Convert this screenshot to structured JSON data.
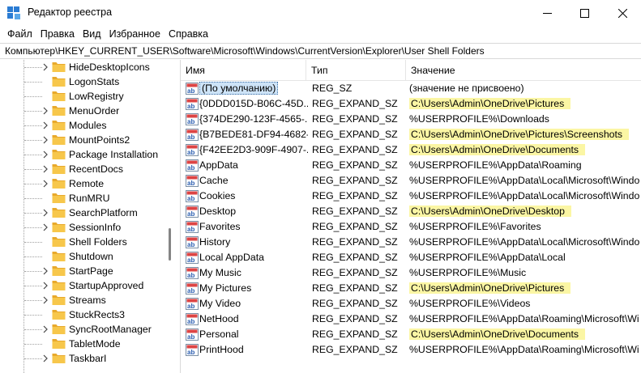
{
  "window": {
    "title": "Редактор реестра",
    "icon": "registry-editor-icon"
  },
  "menu": [
    "Файл",
    "Правка",
    "Вид",
    "Избранное",
    "Справка"
  ],
  "address": "Компьютер\\HKEY_CURRENT_USER\\Software\\Microsoft\\Windows\\CurrentVersion\\Explorer\\User Shell Folders",
  "tree": {
    "items": [
      "HideDesktopIcons",
      "LogonStats",
      "LowRegistry",
      "MenuOrder",
      "Modules",
      "MountPoints2",
      "Package Installation",
      "RecentDocs",
      "Remote",
      "RunMRU",
      "SearchPlatform",
      "SessionInfo",
      "Shell Folders",
      "Shutdown",
      "StartPage",
      "StartupApproved",
      "Streams",
      "StuckRects3",
      "SyncRootManager",
      "TabletMode",
      "TaskbarI"
    ],
    "expandable": [
      true,
      false,
      false,
      true,
      true,
      true,
      true,
      true,
      true,
      false,
      true,
      true,
      false,
      false,
      true,
      true,
      true,
      false,
      true,
      false,
      true
    ]
  },
  "columns": {
    "name": "Имя",
    "type": "Тип",
    "value": "Значение"
  },
  "rows": [
    {
      "name": "(По умолчанию)",
      "type": "REG_SZ",
      "value": "(значение не присвоено)",
      "highlight": false,
      "selected": true
    },
    {
      "name": "{0DDD015D-B06C-45D...",
      "type": "REG_EXPAND_SZ",
      "value": "C:\\Users\\Admin\\OneDrive\\Pictures",
      "highlight": true
    },
    {
      "name": "{374DE290-123F-4565-...",
      "type": "REG_EXPAND_SZ",
      "value": "%USERPROFILE%\\Downloads",
      "highlight": false
    },
    {
      "name": "{B7BEDE81-DF94-4682-...",
      "type": "REG_EXPAND_SZ",
      "value": "C:\\Users\\Admin\\OneDrive\\Pictures\\Screenshots",
      "highlight": true
    },
    {
      "name": "{F42EE2D3-909F-4907-...",
      "type": "REG_EXPAND_SZ",
      "value": "C:\\Users\\Admin\\OneDrive\\Documents",
      "highlight": true
    },
    {
      "name": "AppData",
      "type": "REG_EXPAND_SZ",
      "value": "%USERPROFILE%\\AppData\\Roaming",
      "highlight": false
    },
    {
      "name": "Cache",
      "type": "REG_EXPAND_SZ",
      "value": "%USERPROFILE%\\AppData\\Local\\Microsoft\\Windo",
      "highlight": false
    },
    {
      "name": "Cookies",
      "type": "REG_EXPAND_SZ",
      "value": "%USERPROFILE%\\AppData\\Local\\Microsoft\\Windo",
      "highlight": false
    },
    {
      "name": "Desktop",
      "type": "REG_EXPAND_SZ",
      "value": "C:\\Users\\Admin\\OneDrive\\Desktop",
      "highlight": true
    },
    {
      "name": "Favorites",
      "type": "REG_EXPAND_SZ",
      "value": "%USERPROFILE%\\Favorites",
      "highlight": false
    },
    {
      "name": "History",
      "type": "REG_EXPAND_SZ",
      "value": "%USERPROFILE%\\AppData\\Local\\Microsoft\\Windo",
      "highlight": false
    },
    {
      "name": "Local AppData",
      "type": "REG_EXPAND_SZ",
      "value": "%USERPROFILE%\\AppData\\Local",
      "highlight": false
    },
    {
      "name": "My Music",
      "type": "REG_EXPAND_SZ",
      "value": "%USERPROFILE%\\Music",
      "highlight": false
    },
    {
      "name": "My Pictures",
      "type": "REG_EXPAND_SZ",
      "value": "C:\\Users\\Admin\\OneDrive\\Pictures",
      "highlight": true
    },
    {
      "name": "My Video",
      "type": "REG_EXPAND_SZ",
      "value": "%USERPROFILE%\\Videos",
      "highlight": false
    },
    {
      "name": "NetHood",
      "type": "REG_EXPAND_SZ",
      "value": "%USERPROFILE%\\AppData\\Roaming\\Microsoft\\Wi",
      "highlight": false
    },
    {
      "name": "Personal",
      "type": "REG_EXPAND_SZ",
      "value": "C:\\Users\\Admin\\OneDrive\\Documents",
      "highlight": true
    },
    {
      "name": "PrintHood",
      "type": "REG_EXPAND_SZ",
      "value": "%USERPROFILE%\\AppData\\Roaming\\Microsoft\\Wi",
      "highlight": false
    }
  ],
  "colors": {
    "highlight": "#fbf6a4",
    "folder": "#f7c74b",
    "selection": "#cde3f7"
  }
}
